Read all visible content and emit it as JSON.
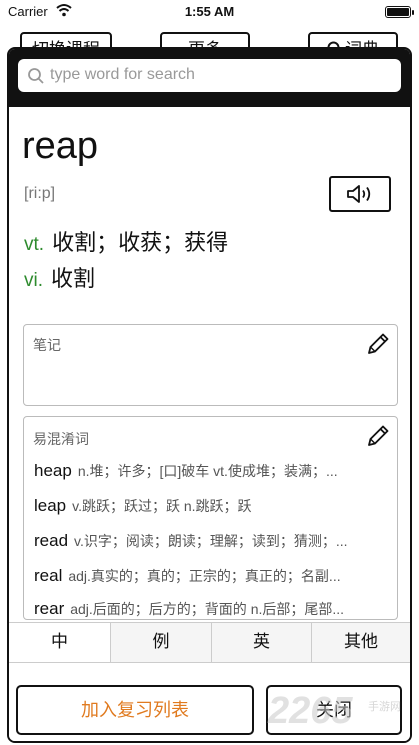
{
  "status_bar": {
    "carrier": "Carrier",
    "time": "1:55 AM",
    "battery_level": 1.0
  },
  "background_toolbar": {
    "switch_course": "切换课程",
    "more": "更多",
    "dictionary": "词典"
  },
  "search": {
    "placeholder": "type word for search",
    "value": ""
  },
  "entry": {
    "word": "reap",
    "phonetic": "[ri:p]",
    "definitions": [
      {
        "pos": "vt.",
        "meaning": "收割；收获；获得"
      },
      {
        "pos": "vi.",
        "meaning": "收割"
      }
    ]
  },
  "notes": {
    "label": "笔记"
  },
  "confusables": {
    "label": "易混淆词",
    "items": [
      {
        "word": "heap",
        "meaning": "n.堆；许多；[口]破车 vt.使成堆；装满；..."
      },
      {
        "word": "leap",
        "meaning": "v.跳跃；跃过；跃 n.跳跃；跃"
      },
      {
        "word": "read",
        "meaning": "v.识字；阅读；朗读；理解；读到；猜测；..."
      },
      {
        "word": "real",
        "meaning": "adj.真实的；真的；正宗的；真正的；名副..."
      },
      {
        "word": "rear",
        "meaning": "adj.后面的；后方的；背面的 n.后部；尾部..."
      }
    ]
  },
  "tabs": [
    "中",
    "例",
    "英",
    "其他"
  ],
  "actions": {
    "add_review": "加入复习列表",
    "close": "关闭"
  },
  "watermark": {
    "brand": "2265",
    "sub": "手游网"
  },
  "colors": {
    "pos": "#2e8b2e",
    "accent": "#e07a1f"
  },
  "icons": {
    "search": "search-icon",
    "speaker": "speaker-icon",
    "edit": "pencil-icon",
    "wifi": "wifi-icon",
    "battery": "battery-icon"
  }
}
